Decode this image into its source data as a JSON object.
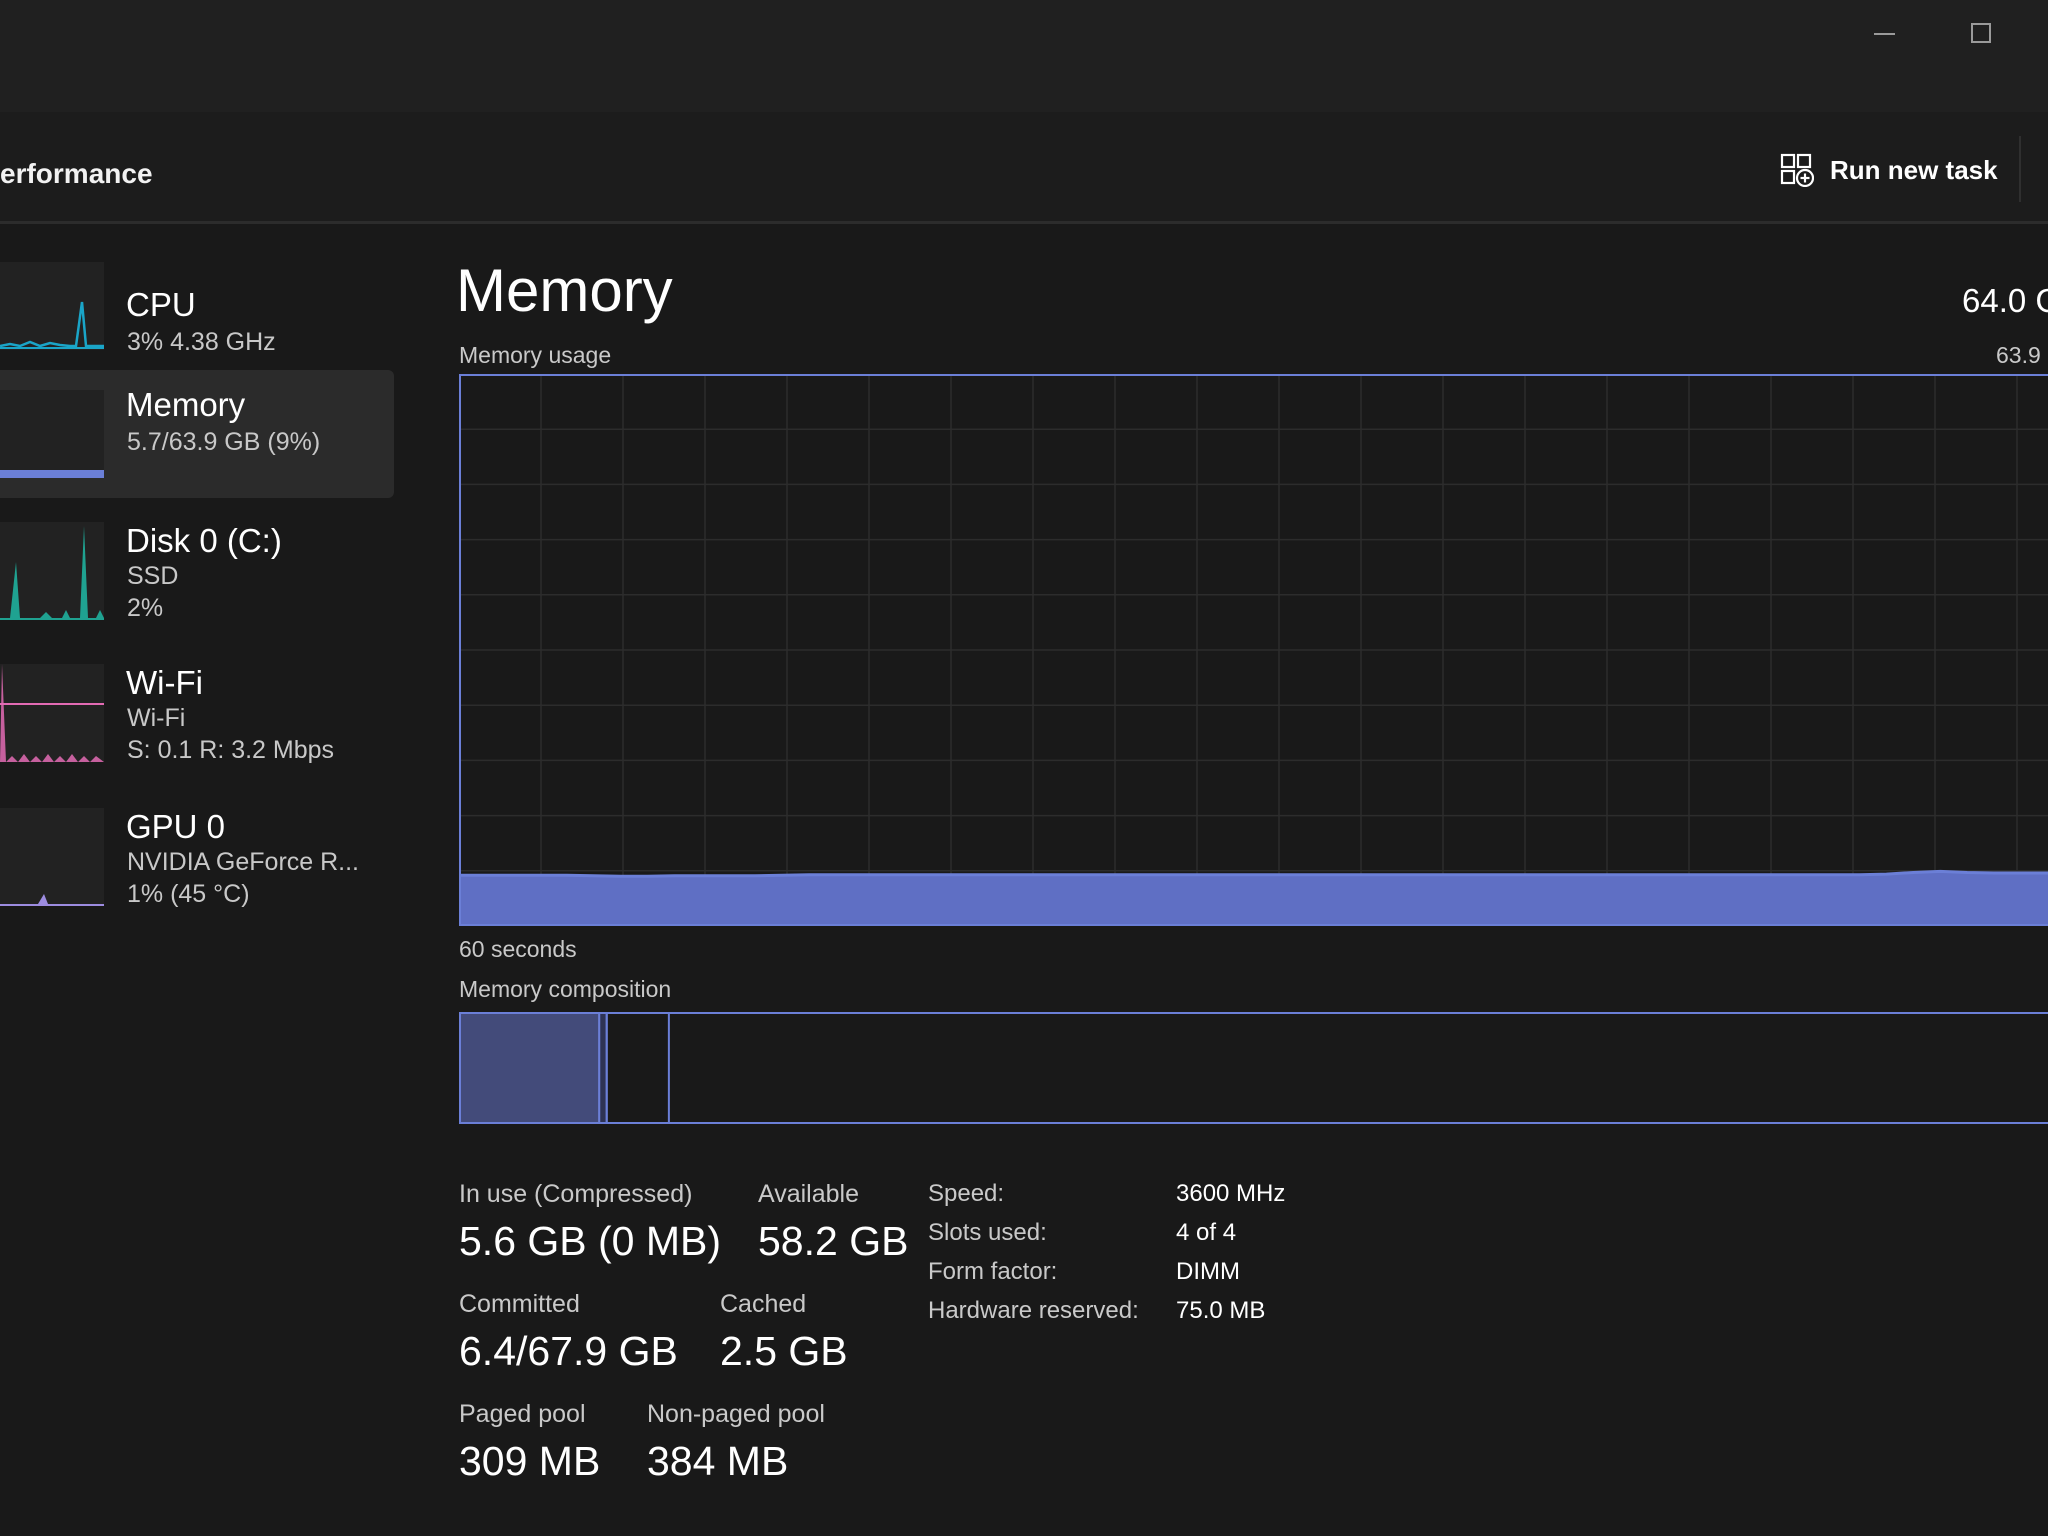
{
  "header": {
    "page_title": "erformance",
    "run_new_task_label": "Run new task"
  },
  "sidebar": {
    "items": [
      {
        "name": "CPU",
        "lines": [
          "3%  4.38 GHz"
        ]
      },
      {
        "name": "Memory",
        "lines": [
          "5.7/63.9 GB (9%)"
        ]
      },
      {
        "name": "Disk 0 (C:)",
        "lines": [
          "SSD",
          "2%"
        ]
      },
      {
        "name": "Wi-Fi",
        "lines": [
          "Wi-Fi",
          "S: 0.1  R: 3.2 Mbps"
        ]
      },
      {
        "name": "GPU 0",
        "lines": [
          "NVIDIA GeForce R...",
          "1%  (45 °C)"
        ]
      }
    ]
  },
  "main": {
    "title": "Memory",
    "total_right": "64.0 G",
    "usage_label": "Memory usage",
    "usage_max_right": "63.9",
    "time_label": "60 seconds",
    "composition_label": "Memory composition"
  },
  "stats": {
    "in_use_label": "In use (Compressed)",
    "in_use_value": "5.6 GB (0 MB)",
    "available_label": "Available",
    "available_value": "58.2 GB",
    "committed_label": "Committed",
    "committed_value": "6.4/67.9 GB",
    "cached_label": "Cached",
    "cached_value": "2.5 GB",
    "paged_pool_label": "Paged pool",
    "paged_pool_value": "309 MB",
    "nonpaged_pool_label": "Non-paged pool",
    "nonpaged_pool_value": "384 MB"
  },
  "details": {
    "speed_label": "Speed:",
    "speed_value": "3600 MHz",
    "slots_label": "Slots used:",
    "slots_value": "4 of 4",
    "form_label": "Form factor:",
    "form_value": "DIMM",
    "hw_reserved_label": "Hardware reserved:",
    "hw_reserved_value": "75.0 MB"
  },
  "colors": {
    "memory_accent": "#6b7fd7",
    "cpu_accent": "#1aa5c8",
    "disk_accent": "#1fb8a4",
    "wifi_accent": "#e36bb4",
    "gpu_accent": "#9d8ce0"
  },
  "chart_data": {
    "type": "area",
    "series": [
      {
        "values": [
          9.2,
          9.2,
          9.2,
          9.2,
          9.2,
          9.1,
          9.0,
          9.0,
          9.1,
          9.1,
          9.1,
          9.1,
          9.2,
          9.3,
          9.3,
          9.3,
          9.3,
          9.3,
          9.3,
          9.3,
          9.3,
          9.3,
          9.3,
          9.3,
          9.3,
          9.3,
          9.3,
          9.3,
          9.3,
          9.3,
          9.3,
          9.3,
          9.3,
          9.3,
          9.3,
          9.3,
          9.3,
          9.3,
          9.3,
          9.3,
          9.3,
          9.3,
          9.3,
          9.3,
          9.3,
          9.3,
          9.3,
          9.3,
          9.3,
          9.3,
          9.3,
          9.3,
          9.3,
          9.4,
          9.7,
          9.9,
          9.7,
          9.6,
          9.6,
          9.6
        ]
      }
    ],
    "composition": {
      "in_use": 5.6,
      "modified": 0.3,
      "standby": 2.5,
      "total": 63.9
    }
  }
}
